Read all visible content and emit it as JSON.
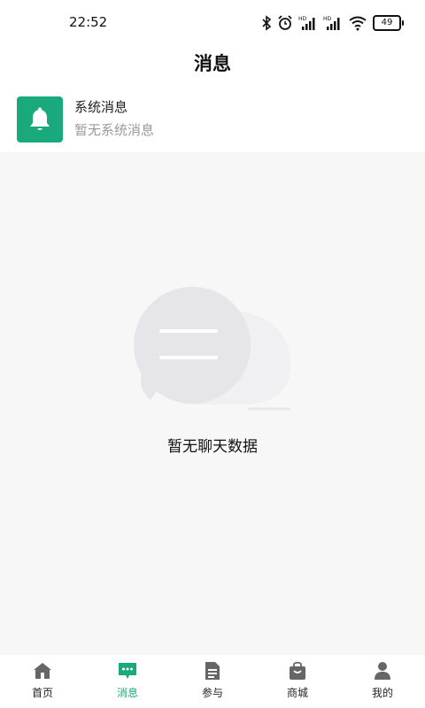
{
  "status_bar": {
    "time": "22:52",
    "battery": "49",
    "icons": [
      "bluetooth-icon",
      "alarm-icon",
      "signal-hd-icon",
      "signal-hd-icon",
      "wifi-icon",
      "battery-icon"
    ]
  },
  "header": {
    "title": "消息"
  },
  "system_message": {
    "title": "系统消息",
    "subtitle": "暂无系统消息",
    "icon": "bell-icon",
    "icon_bg": "#1aa97c"
  },
  "empty_state": {
    "text": "暂无聊天数据",
    "icon": "chat-bubble-icon"
  },
  "tabbar": {
    "active_color": "#1aa97c",
    "inactive_color": "#666666",
    "items": [
      {
        "label": "首页",
        "icon": "home-icon"
      },
      {
        "label": "消息",
        "icon": "message-icon"
      },
      {
        "label": "参与",
        "icon": "document-icon"
      },
      {
        "label": "商城",
        "icon": "shopping-bag-icon"
      },
      {
        "label": "我的",
        "icon": "user-icon"
      }
    ]
  }
}
